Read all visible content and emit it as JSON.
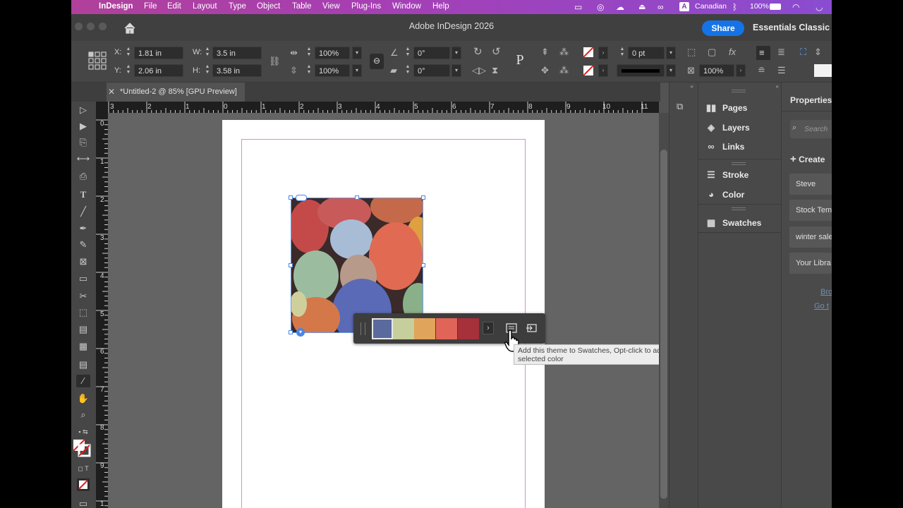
{
  "menubar": {
    "app_name": "InDesign",
    "items": [
      "File",
      "Edit",
      "Layout",
      "Type",
      "Object",
      "Table",
      "View",
      "Plug-Ins",
      "Window",
      "Help"
    ],
    "status": {
      "input_source": "Canadian",
      "input_badge": "A",
      "battery": "100%"
    }
  },
  "titlebar": {
    "title": "Adobe InDesign 2026",
    "share": "Share",
    "workspace": "Essentials Classic"
  },
  "control": {
    "x_label": "X:",
    "x_value": "1.81 in",
    "y_label": "Y:",
    "y_value": "2.06 in",
    "w_label": "W:",
    "w_value": "3.5 in",
    "h_label": "H:",
    "h_value": "3.58 in",
    "scale_x": "100%",
    "scale_y": "100%",
    "rotate": "0°",
    "shear": "0°",
    "stroke_weight": "0 pt",
    "opacity": "100%",
    "proxy_letter": "P"
  },
  "document": {
    "tab_title": "*Untitled-2 @ 85% [GPU Preview]"
  },
  "rulers": {
    "h": [
      "3",
      "2",
      "1",
      "0",
      "1",
      "2",
      "3",
      "4",
      "5",
      "6",
      "7",
      "8",
      "9",
      "10",
      "11"
    ],
    "v": [
      "0",
      "1",
      "2",
      "3",
      "4",
      "5",
      "6",
      "7",
      "8",
      "9",
      "1"
    ]
  },
  "theme": {
    "swatches": [
      "#5a6a9e",
      "#c6ce9c",
      "#e0a45a",
      "#e16458",
      "#a6313a"
    ],
    "tooltip": "Add this theme to Swatches, Opt-click to add selected color"
  },
  "panels": {
    "items": [
      {
        "label": "Pages",
        "icon": "pages-icon"
      },
      {
        "label": "Layers",
        "icon": "layers-icon"
      },
      {
        "label": "Links",
        "icon": "links-icon"
      },
      {
        "label": "Stroke",
        "icon": "stroke-icon"
      },
      {
        "label": "Color",
        "icon": "color-icon"
      },
      {
        "label": "Swatches",
        "icon": "swatches-icon"
      }
    ]
  },
  "properties": {
    "title": "Properties",
    "search_placeholder": "Search",
    "create": "Create",
    "libraries": [
      "Steve",
      "Stock Tem",
      "winter sale",
      "Your Libra"
    ],
    "links": [
      "Bro",
      "Go t"
    ]
  }
}
